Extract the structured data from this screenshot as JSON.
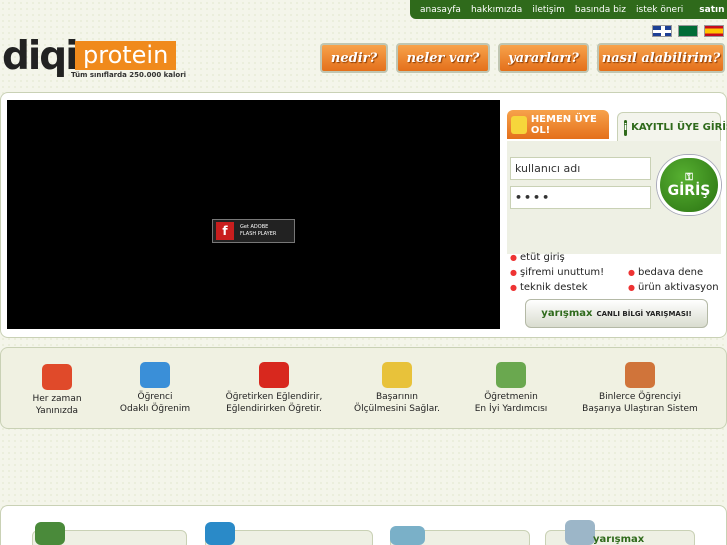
{
  "topnav": {
    "items": [
      "anasayfa",
      "hakkımızda",
      "iletişim",
      "basında biz",
      "istek öneri"
    ],
    "buy": "satın al!"
  },
  "logo": {
    "part1": "diqi",
    "part2": "protein",
    "slogan": "Tüm sınıflarda 250.000 kalori"
  },
  "mainnav": [
    "nedir?",
    "neler var?",
    "yararları?",
    "nasıl alabilirim?"
  ],
  "flash": {
    "line1": "Get ADOBE",
    "line2": "FLASH PLAYER"
  },
  "login": {
    "signup_tab": "HEMEN ÜYE OL!",
    "login_tab": "KAYITLI ÜYE GİRİŞİ",
    "user_value": "kullanıcı adı",
    "pass_value": "••••",
    "submit": "GİRİŞ",
    "links": {
      "etut": "etüt giriş",
      "forgot": "şifremi unuttum!",
      "try": "bedava dene",
      "support": "teknik destek",
      "activate": "ürün aktivasyon"
    },
    "contest_brand": "yarışmax",
    "contest_label": "CANLI BİLGİ YARIŞMASI!"
  },
  "features": [
    {
      "l1": "Her zaman",
      "l2": "Yanınızda",
      "color": "#e04a2a"
    },
    {
      "l1": "Öğrenci",
      "l2": "Odaklı Öğrenim",
      "color": "#3a8fd8"
    },
    {
      "l1": "Öğretirken Eğlendirir,",
      "l2": "Eğlendirirken Öğretir.",
      "color": "#d8281e"
    },
    {
      "l1": "Başarının",
      "l2": "Ölçülmesini Sağlar.",
      "color": "#e8c23a"
    },
    {
      "l1": "Öğretmenin",
      "l2": "En İyi Yardımcısı",
      "color": "#6aa84f"
    },
    {
      "l1": "Binlerce Öğrenciyi",
      "l2": "Başarıya Ulaştıran Sistem",
      "color": "#d0743a"
    }
  ],
  "bottom_brand": "yarışmax"
}
